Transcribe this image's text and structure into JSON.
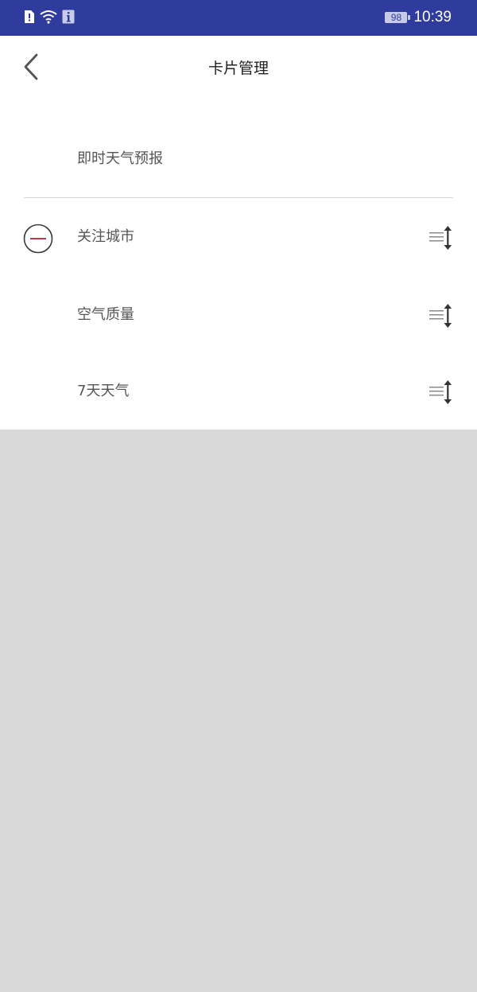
{
  "status_bar": {
    "time": "10:39",
    "battery": "98",
    "icons": [
      "sim-alert-icon",
      "wifi-icon",
      "info-badge-icon",
      "battery-icon"
    ]
  },
  "nav": {
    "title": "卡片管理",
    "back_icon": "chevron-left-icon"
  },
  "fixed_card": {
    "label": "即时天气预报"
  },
  "cards": [
    {
      "label": "关注城市",
      "removable": true
    },
    {
      "label": "空气质量",
      "removable": false
    },
    {
      "label": "7天天气",
      "removable": false
    }
  ],
  "colors": {
    "status_bar": "#2f3c9e",
    "remove_accent": "#c0394b",
    "background": "#d9d9d9"
  }
}
